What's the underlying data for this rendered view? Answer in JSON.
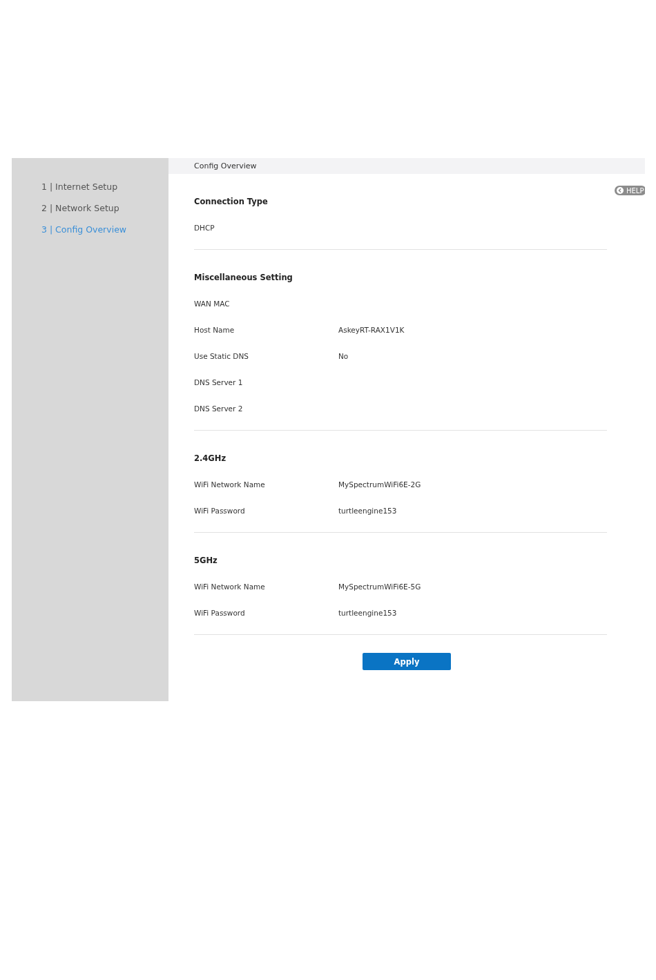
{
  "steps": [
    {
      "label": "1 | Internet Setup",
      "selected": false
    },
    {
      "label": "2 | Network Setup",
      "selected": false
    },
    {
      "label": "3 | Config Overview",
      "selected": true
    }
  ],
  "header": {
    "title": "Config Overview"
  },
  "help_button": {
    "label": "HELP"
  },
  "sections": [
    {
      "title": "Connection Type",
      "rows": [
        {
          "label": "DHCP"
        }
      ]
    },
    {
      "title": "Miscellaneous Setting",
      "rows": [
        {
          "label": "WAN MAC"
        },
        {
          "label": "Host Name",
          "value": "AskeyRT-RAX1V1K"
        },
        {
          "label": "Use Static DNS",
          "value": "No"
        },
        {
          "label": "DNS Server 1"
        },
        {
          "label": "DNS Server 2"
        }
      ]
    },
    {
      "title": "2.4GHz",
      "rows": [
        {
          "label": "WiFi Network Name",
          "value": "MySpectrumWiFi6E-2G"
        },
        {
          "label": "WiFi Password",
          "value": "turtleengine153"
        }
      ]
    },
    {
      "title": "5GHz",
      "rows": [
        {
          "label": "WiFi Network Name",
          "value": "MySpectrumWiFi6E-5G"
        },
        {
          "label": "WiFi Password",
          "value": "turtleengine153"
        }
      ]
    }
  ],
  "apply_button": {
    "label": "Apply"
  }
}
